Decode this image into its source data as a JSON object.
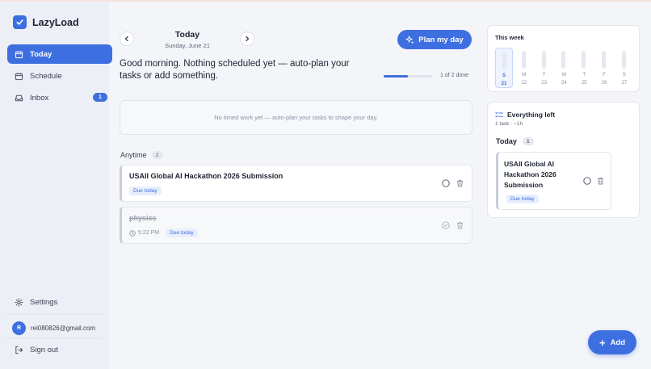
{
  "app": {
    "name": "LazyLoad"
  },
  "theme": {
    "accent": "#3e6fe0",
    "sidebar_bg": "#eceff6",
    "page_bg": "#f3f5f9"
  },
  "sidebar": {
    "items": [
      {
        "label": "Today",
        "icon": "calendar-today-icon",
        "active": true
      },
      {
        "label": "Schedule",
        "icon": "calendar-icon",
        "active": false
      },
      {
        "label": "Inbox",
        "icon": "inbox-icon",
        "active": false,
        "badge": "1"
      }
    ],
    "settings_label": "Settings",
    "user": {
      "initial": "R",
      "email": "rei080826@gmail.com"
    },
    "signout_label": "Sign out"
  },
  "header": {
    "title": "Today",
    "date": "Sunday, June 21",
    "plan_button": "Plan my day",
    "greeting": "Good morning. Nothing scheduled yet — auto-plan your tasks or add something.",
    "progress_label": "1 of 2 done",
    "progress_fraction": 0.5
  },
  "timed": {
    "empty_text": "No timed work yet — auto-plan your tasks to shape your day."
  },
  "anytime": {
    "title": "Anytime",
    "count": "2",
    "tasks": [
      {
        "title": "USAII Global AI Hackathon 2026 Submission",
        "tag": "Due today",
        "done": false
      },
      {
        "title": "physics",
        "time": "5:22 PM",
        "tag": "Due today",
        "done": true
      }
    ]
  },
  "week": {
    "title": "This week",
    "days": [
      {
        "letter": "S",
        "num": "21",
        "active": true
      },
      {
        "letter": "M",
        "num": "22",
        "active": false
      },
      {
        "letter": "T",
        "num": "23",
        "active": false
      },
      {
        "letter": "W",
        "num": "24",
        "active": false
      },
      {
        "letter": "T",
        "num": "25",
        "active": false
      },
      {
        "letter": "F",
        "num": "26",
        "active": false
      },
      {
        "letter": "S",
        "num": "27",
        "active": false
      }
    ]
  },
  "everything_left": {
    "title": "Everything left",
    "summary": "1 task · ~1h",
    "group_title": "Today",
    "group_count": "1",
    "task": {
      "title": "USAII Global AI Hackathon 2026 Submission",
      "tag": "Due today"
    }
  },
  "add_button": "Add"
}
